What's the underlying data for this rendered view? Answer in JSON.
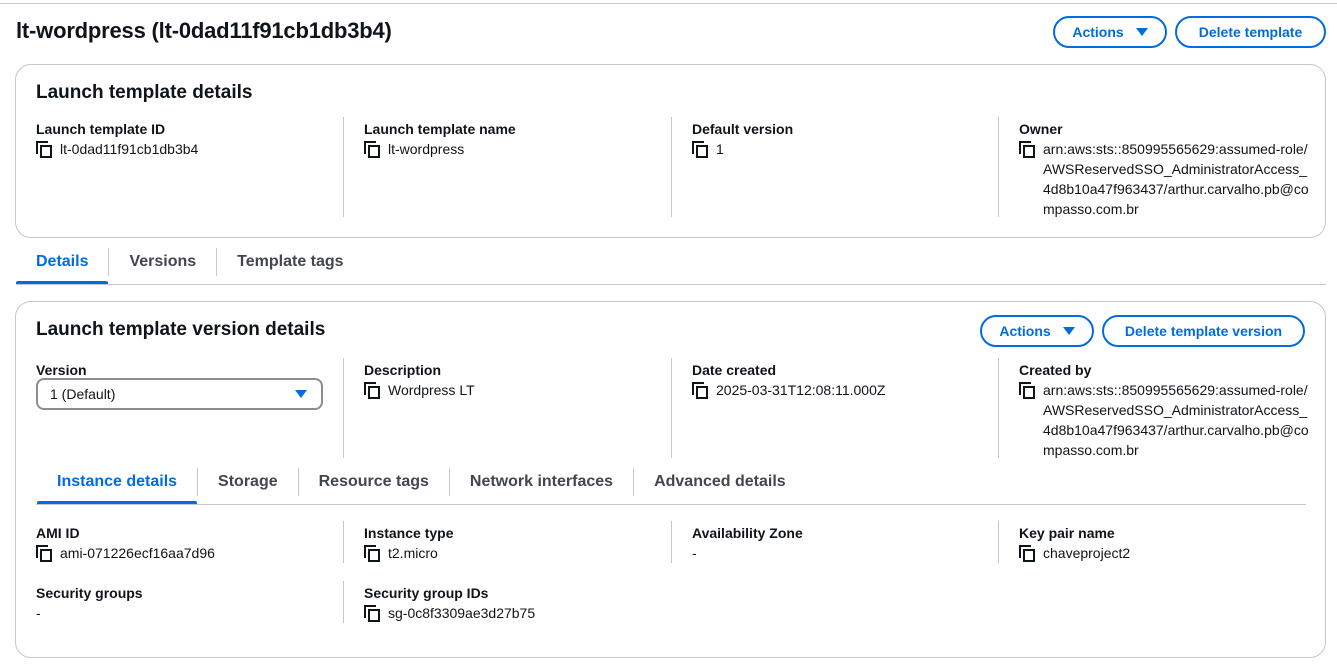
{
  "page": {
    "title": "lt-wordpress (lt-0dad11f91cb1db3b4)",
    "actions_label": "Actions",
    "delete_label": "Delete template"
  },
  "template_details": {
    "title": "Launch template details",
    "fields": [
      {
        "label": "Launch template ID",
        "value": "lt-0dad11f91cb1db3b4"
      },
      {
        "label": "Launch template name",
        "value": "lt-wordpress"
      },
      {
        "label": "Default version",
        "value": "1"
      },
      {
        "label": "Owner",
        "value": "arn:aws:sts::850995565629:assumed-role/AWSReservedSSO_AdministratorAccess_4d8b10a47f963437/arthur.carvalho.pb@compasso.com.br"
      }
    ]
  },
  "main_tabs": [
    "Details",
    "Versions",
    "Template tags"
  ],
  "version_details": {
    "title": "Launch template version details",
    "actions_label": "Actions",
    "delete_label": "Delete template version",
    "version_label": "Version",
    "version_selected": "1 (Default)",
    "description_label": "Description",
    "description_value": "Wordpress LT",
    "date_label": "Date created",
    "date_value": "2025-03-31T12:08:11.000Z",
    "created_by_label": "Created by",
    "created_by_value": "arn:aws:sts::850995565629:assumed-role/AWSReservedSSO_AdministratorAccess_4d8b10a47f963437/arthur.carvalho.pb@compasso.com.br"
  },
  "sub_tabs": [
    "Instance details",
    "Storage",
    "Resource tags",
    "Network interfaces",
    "Advanced details"
  ],
  "instance": {
    "ami_label": "AMI ID",
    "ami_value": "ami-071226ecf16aa7d96",
    "type_label": "Instance type",
    "type_value": "t2.micro",
    "az_label": "Availability Zone",
    "az_value": "-",
    "key_label": "Key pair name",
    "key_value": "chaveproject2",
    "sg_label": "Security groups",
    "sg_value": "-",
    "sgid_label": "Security group IDs",
    "sgid_value": "sg-0c8f3309ae3d27b75"
  }
}
